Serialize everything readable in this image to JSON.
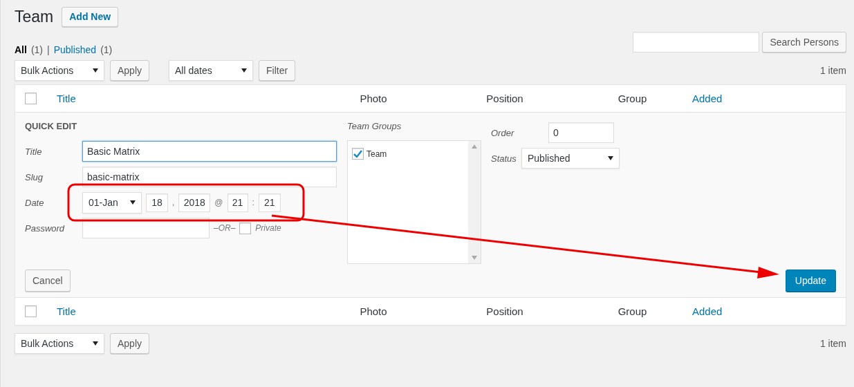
{
  "header": {
    "title": "Team",
    "add_new": "Add New"
  },
  "views": [
    {
      "label": "All",
      "count": "(1)",
      "selected": true
    },
    {
      "label": "Published",
      "count": "(1)",
      "selected": false
    }
  ],
  "separator": "|",
  "search": {
    "button": "Search Persons"
  },
  "top_nav": {
    "bulk_actions": "Bulk Actions",
    "apply": "Apply",
    "date_filter": "All dates",
    "filter": "Filter",
    "count": "1 item"
  },
  "header_select_all_checked": false,
  "header_columns": [
    {
      "label": "Title",
      "sortable": true
    },
    {
      "label": "Photo",
      "sortable": false
    },
    {
      "label": "Position",
      "sortable": false
    },
    {
      "label": "Group",
      "sortable": false
    },
    {
      "label": "Added",
      "sortable": true
    }
  ],
  "quick_edit": {
    "heading": "QUICK EDIT",
    "title_label": "Title",
    "title_value": "Basic Matrix",
    "slug_label": "Slug",
    "slug_value": "basic-matrix",
    "date_label": "Date",
    "month": "01-Jan",
    "day": "18",
    "comma": ",",
    "year": "2018",
    "at": "@",
    "hour": "21",
    "colon": ":",
    "minute": "21",
    "password_label": "Password",
    "or_text": "–OR–",
    "private_label": "Private",
    "private_checked": false,
    "groups_label": "Team Groups",
    "groups": [
      {
        "label": "Team",
        "checked": true
      }
    ],
    "order_label": "Order",
    "order_value": "0",
    "status_label": "Status",
    "status_value": "Published",
    "cancel": "Cancel",
    "update": "Update"
  },
  "footer_select_all_checked": false,
  "footer_columns": [
    {
      "label": "Title",
      "sortable": true
    },
    {
      "label": "Photo",
      "sortable": false
    },
    {
      "label": "Position",
      "sortable": false
    },
    {
      "label": "Group",
      "sortable": false
    },
    {
      "label": "Added",
      "sortable": true
    }
  ],
  "bottom_nav": {
    "bulk_actions": "Bulk Actions",
    "apply": "Apply",
    "count": "1 item"
  },
  "annotation": {
    "outline": true,
    "arrow": true
  }
}
